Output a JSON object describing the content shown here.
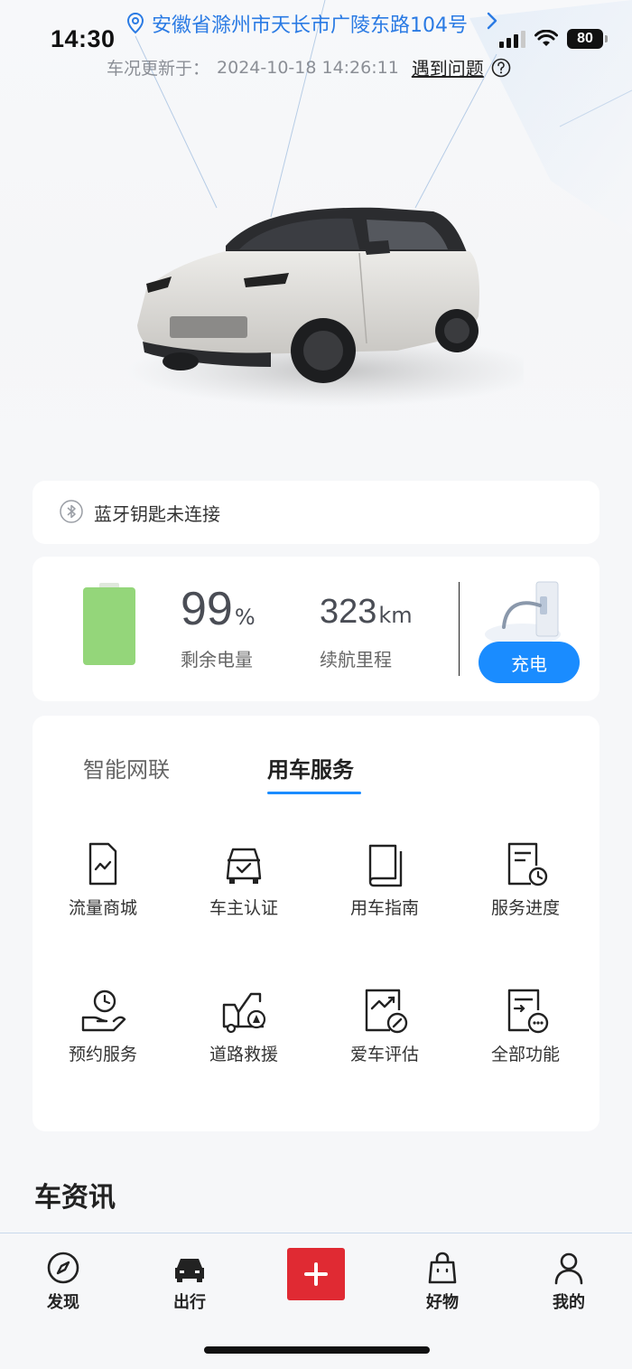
{
  "status_bar": {
    "time": "14:30",
    "battery": "80"
  },
  "header": {
    "location": "安徽省滁州市天长市广陵东路104号",
    "update_prefix": "车况更新于：",
    "update_time": "2024-10-18 14:26:11",
    "problem_link": "遇到问题"
  },
  "bluetooth": {
    "label": "蓝牙钥匙未连接"
  },
  "energy": {
    "battery_percent": "99",
    "battery_unit": "%",
    "battery_label": "剩余电量",
    "range_value": "323",
    "range_unit": "km",
    "range_label": "续航里程",
    "charge_button": "充电",
    "battery_color": "#94d67a"
  },
  "service_tabs": [
    {
      "label": "智能网联",
      "active": false
    },
    {
      "label": "用车服务",
      "active": true
    }
  ],
  "services": [
    {
      "label": "流量商城",
      "icon": "sim-card-icon"
    },
    {
      "label": "车主认证",
      "icon": "car-check-icon"
    },
    {
      "label": "用车指南",
      "icon": "book-icon"
    },
    {
      "label": "服务进度",
      "icon": "document-clock-icon"
    },
    {
      "label": "预约服务",
      "icon": "hand-clock-icon"
    },
    {
      "label": "道路救援",
      "icon": "tow-truck-icon"
    },
    {
      "label": "爱车评估",
      "icon": "chart-edit-icon"
    },
    {
      "label": "全部功能",
      "icon": "document-more-icon"
    }
  ],
  "news": {
    "title": "车资讯"
  },
  "bottom_nav": [
    {
      "label": "发现",
      "icon": "compass-icon"
    },
    {
      "label": "出行",
      "icon": "car-icon"
    },
    {
      "label": "",
      "icon": "plus-icon"
    },
    {
      "label": "好物",
      "icon": "shopping-bag-icon"
    },
    {
      "label": "我的",
      "icon": "person-icon"
    }
  ],
  "colors": {
    "accent": "#1a8cff",
    "location_text": "#2b7be4",
    "add_button": "#e02a33"
  }
}
